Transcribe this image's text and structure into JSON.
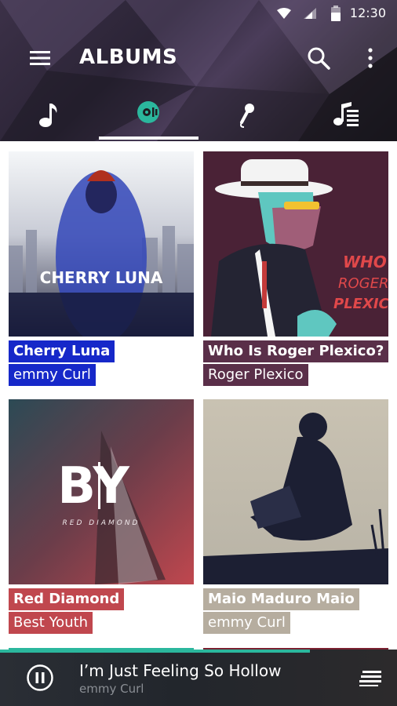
{
  "status": {
    "time": "12:30"
  },
  "toolbar": {
    "title": "ALBUMS"
  },
  "tabs": [
    {
      "id": "songs",
      "icon": "music-note-icon"
    },
    {
      "id": "albums",
      "icon": "album-disc-icon",
      "selected": true
    },
    {
      "id": "artists",
      "icon": "microphone-icon"
    },
    {
      "id": "playlists",
      "icon": "playlist-icon"
    }
  ],
  "albums": [
    {
      "title": "Cherry Luna",
      "artist": "emmy Curl",
      "cover_text": "CHERRY LUNA",
      "color": "#1628c9"
    },
    {
      "title": "Who Is Roger Plexico?",
      "artist": "Roger Plexico",
      "cover_text": "WHO IS ROGER PLEXICO",
      "color": "#5a2f49"
    },
    {
      "title": "Red Diamond",
      "artist": "Best Youth",
      "cover_text": "BY",
      "cover_subtext": "RED DIAMOND",
      "color": "#c0474e"
    },
    {
      "title": "Maio Maduro Maio",
      "artist": "emmy Curl",
      "color": "#b6ad9f"
    }
  ],
  "now_playing": {
    "title": "I’m Just Feeling So Hollow",
    "artist": "emmy Curl",
    "progress": 0.78,
    "accent": "#2bb79d"
  }
}
